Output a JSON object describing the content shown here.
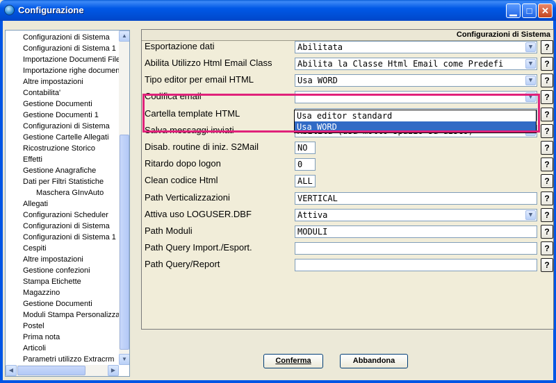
{
  "window": {
    "title": "Configurazione",
    "minimize_glyph": "▁",
    "maximize_glyph": "□",
    "close_glyph": "✕"
  },
  "sidebar": {
    "items": [
      {
        "label": "Configurazioni di Sistema",
        "level": 1
      },
      {
        "label": "Configurazioni di Sistema 1",
        "level": 1
      },
      {
        "label": "Importazione Documenti File",
        "level": 1
      },
      {
        "label": "Importazione righe documenti",
        "level": 1
      },
      {
        "label": "Altre impostazioni",
        "level": 1
      },
      {
        "label": "Contabilita'",
        "level": 1
      },
      {
        "label": "Gestione Documenti",
        "level": 1
      },
      {
        "label": "Gestione Documenti 1",
        "level": 1
      },
      {
        "label": "Configurazioni di Sistema",
        "level": 1
      },
      {
        "label": "Gestione Cartelle Allegati",
        "level": 1
      },
      {
        "label": "Ricostruzione Storico",
        "level": 1
      },
      {
        "label": "Effetti",
        "level": 1
      },
      {
        "label": "Gestione Anagrafiche",
        "level": 1
      },
      {
        "label": "Dati per Filtri Statistiche",
        "level": 1
      },
      {
        "label": "Maschera GInvAuto",
        "level": 2
      },
      {
        "label": "Allegati",
        "level": 1
      },
      {
        "label": "Configurazioni Scheduler",
        "level": 1
      },
      {
        "label": "Configurazioni di Sistema",
        "level": 1
      },
      {
        "label": "Configurazioni di Sistema 1",
        "level": 1
      },
      {
        "label": "Cespiti",
        "level": 1
      },
      {
        "label": "Altre impostazioni",
        "level": 1
      },
      {
        "label": "Gestione confezioni",
        "level": 1
      },
      {
        "label": "Stampa Etichette",
        "level": 1
      },
      {
        "label": "Magazzino",
        "level": 1
      },
      {
        "label": "Gestione Documenti",
        "level": 1
      },
      {
        "label": "Moduli Stampa Personalizzati",
        "level": 1
      },
      {
        "label": "Postel",
        "level": 1
      },
      {
        "label": "Prima nota",
        "level": 1
      },
      {
        "label": "Articoli",
        "level": 1
      },
      {
        "label": "Parametri utilizzo Extracrm",
        "level": 1
      }
    ],
    "scroll_up_glyph": "▲",
    "scroll_down_glyph": "▼",
    "scroll_left_glyph": "◀",
    "scroll_right_glyph": "▶"
  },
  "panel": {
    "header": "Configurazioni di Sistema",
    "help_label": "?",
    "combo_arrow_glyph": "▼",
    "rows": [
      {
        "label": "Esportazione dati",
        "kind": "combo",
        "value": "Abilitata"
      },
      {
        "label": "Abilita Utilizzo Html Email Class",
        "kind": "combo",
        "value": "Abilita la Classe Html Email come Predefi"
      },
      {
        "label": "Tipo editor per email HTML",
        "kind": "combo",
        "value": "Usa WORD"
      },
      {
        "label": "Codifica email",
        "kind": "combo",
        "value": ""
      },
      {
        "label": "Cartella template HTML",
        "kind": "text",
        "value": ""
      },
      {
        "label": "Salva messaggi inviati",
        "kind": "combo",
        "value": "Abilita (usa molto spazio su disco)"
      },
      {
        "label": "Disab. routine di iniz. S2Mail",
        "kind": "small",
        "value": "NO"
      },
      {
        "label": "Ritardo dopo logon",
        "kind": "small",
        "value": "0"
      },
      {
        "label": "Clean codice Html",
        "kind": "small",
        "value": "ALL"
      },
      {
        "label": "Path Verticalizzazioni",
        "kind": "text",
        "value": "VERTICAL"
      },
      {
        "label": "Attiva uso LOGUSER.DBF",
        "kind": "combo",
        "value": "Attiva"
      },
      {
        "label": "Path Moduli",
        "kind": "text",
        "value": "MODULI"
      },
      {
        "label": "Path Query Import./Esport.",
        "kind": "text",
        "value": ""
      },
      {
        "label": "Path Query/Report",
        "kind": "text",
        "value": ""
      }
    ],
    "dropdown": {
      "options": [
        "Usa editor standard",
        "Usa WORD"
      ],
      "selected": "Usa WORD"
    }
  },
  "buttons": {
    "confirm": "Conferma",
    "abandon": "Abbandona"
  },
  "colors": {
    "titlebar": "#0058e6",
    "highlight": "#e0217a",
    "selection": "#316ac5",
    "panel_bg": "#f1edd9"
  }
}
